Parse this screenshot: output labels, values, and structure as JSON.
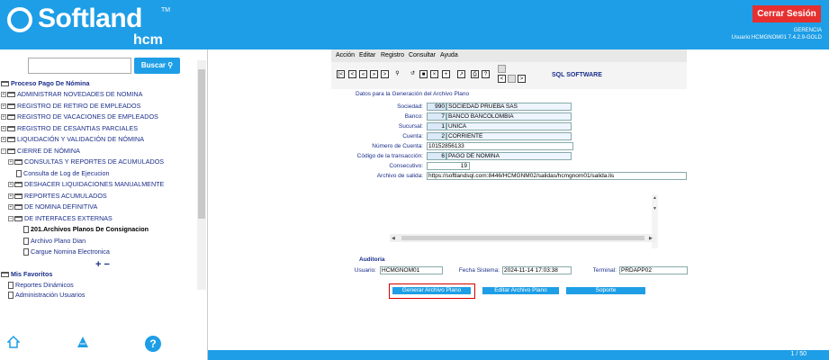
{
  "header": {
    "brand": "Softland",
    "brand_tm": "TM",
    "brand_sub": "hcm",
    "logout_label": "Cerrar Sesión",
    "company": "GERENCIA",
    "user_info": "Usuario:HCMGNOM01 7.4.2.9-GOLD"
  },
  "sidebar": {
    "search_label": "Buscar",
    "search_value": "",
    "tree": {
      "root": "Proceso Pago De Nómina",
      "items": [
        "ADMINISTRAR NOVEDADES DE NOMINA",
        "REGISTRO DE RETIRO DE EMPLEADOS",
        "REGISTRO DE VACACIONES DE EMPLEADOS",
        "REGISTRO DE CESANTIAS PARCIALES",
        "LIQUIDACIÓN Y VALIDACIÓN DE NÓMINA",
        "CIERRE DE NÓMINA"
      ],
      "cierre_children": [
        "CONSULTAS Y REPORTES DE ACUMULADOS",
        "Consulta de Log de Ejecucion",
        "DESHACER LIQUIDACIONES MANUALMENTE",
        "REPORTES ACUMULADOS",
        "DE NOMINA DEFINITIVA",
        "DE INTERFACES EXTERNAS"
      ],
      "interfaces_children": [
        "201.Archivos Planos De Consignacion",
        "Archivo Plano Dian",
        "Cargue Nomina Electronica"
      ],
      "favorites_root": "Mis Favoritos",
      "favorites": [
        "Reportes Dinámicos",
        "Administración Usuarios"
      ]
    },
    "plusminus": "+ −"
  },
  "menu": {
    "items": [
      "Acción",
      "Editar",
      "Registro",
      "Consultar",
      "Ayuda"
    ]
  },
  "toolbar": {
    "vendor": "SQL SOFTWARE"
  },
  "form": {
    "title": "Datos para la Generación del Archivo Plano",
    "sociedad_label": "Sociedad:",
    "sociedad_code": "990",
    "sociedad_name": "SOCIEDAD  PRUEBA SAS",
    "banco_label": "Banco:",
    "banco_code": "7",
    "banco_name": "BANCO BANCOLOMBIA",
    "sucursal_label": "Sucursal:",
    "sucursal_code": "1",
    "sucursal_name": "UNICA",
    "cuenta_label": "Cuenta:",
    "cuenta_code": "2",
    "cuenta_name": "CORRIENTE",
    "numcuenta_label": "Número de Cuenta:",
    "numcuenta_value": "10152856133",
    "codtrans_label": "Código de la transacción:",
    "codtrans_code": "6",
    "codtrans_name": "PAGO DE NOMINA",
    "consecutivo_label": "Consecutivo:",
    "consecutivo_value": "19",
    "archivo_label": "Archivo de salida:",
    "archivo_value": "https://softlandsql.com:8446/HCMGNM02/salidas/hcmgnom01/salida.lis"
  },
  "audit": {
    "title": "Auditoria",
    "usuario_label": "Usuario:",
    "usuario_value": "HCMGNOM01",
    "fecha_label": "Fecha Sistema:",
    "fecha_value": "2024-11-14 17:03:38",
    "terminal_label": "Terminal:",
    "terminal_value": "PRDAPP02"
  },
  "buttons": {
    "generar": "Generar Archivo Plano",
    "editar": "Editar Archivo Plano",
    "soporte": "Soporte"
  },
  "footer": {
    "pager": "1 / 50"
  },
  "colors": {
    "brand_blue": "#1e9ee6",
    "logout_red": "#e63030",
    "label_navy": "#1b2f8a",
    "highlight_red": "#d00000"
  }
}
